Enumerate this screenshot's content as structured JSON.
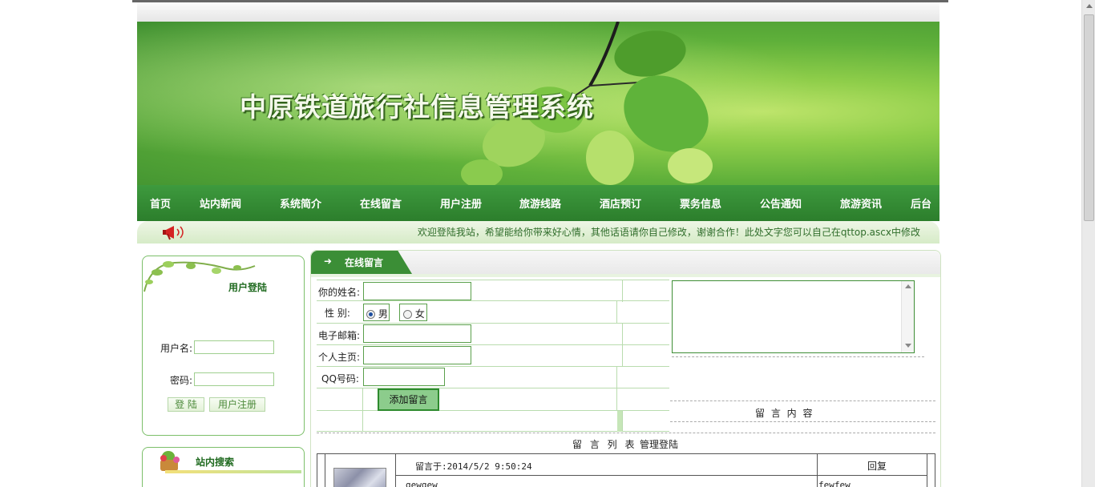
{
  "banner": {
    "title": "中原铁道旅行社信息管理系统"
  },
  "nav": [
    "首页",
    "站内新闻",
    "系统简介",
    "在线留言",
    "用户注册",
    "旅游线路",
    "酒店预订",
    "票务信息",
    "公告通知",
    "旅游资讯",
    "后台"
  ],
  "welcome": {
    "text": "欢迎登陆我站，希望能给你带来好心情，其他话语请你自己修改，谢谢合作！此处文字您可以自己在qttop.ascx中修改"
  },
  "login": {
    "title": "用户登陆",
    "username_label": "用户名:",
    "password_label": "密码:",
    "login_button": "登 陆",
    "register_button": "用户注册"
  },
  "search": {
    "title": "站内搜索"
  },
  "message": {
    "tab_title": "在线留言",
    "name_label": "你的姓名:",
    "gender_label": "性 别:",
    "gender_male": "男",
    "gender_female": "女",
    "email_label": "电子邮箱:",
    "homepage_label": "个人主页:",
    "qq_label": "QQ号码:",
    "add_button": "添加留言",
    "content_label": "留 言 内 容",
    "list_title": "留 言 列 表",
    "admin_login": "管理登陆",
    "entry": {
      "posted": "留言于:2014/5/2 9:50:24",
      "reply": "回复",
      "text": "gewgew",
      "reply_text": "fewfew"
    }
  }
}
